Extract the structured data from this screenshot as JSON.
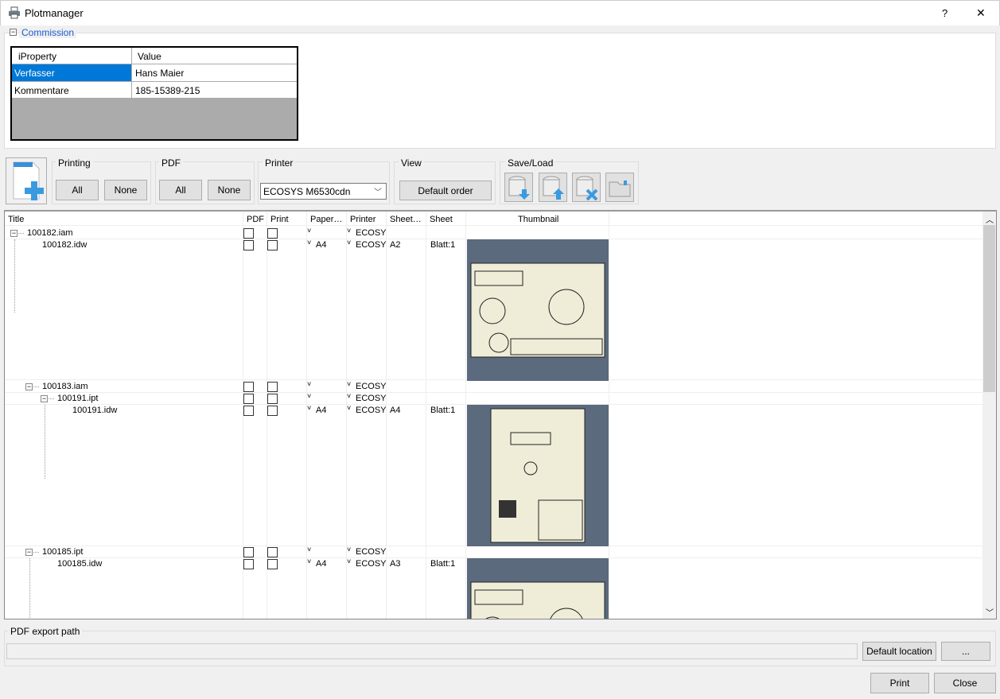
{
  "window": {
    "title": "Plotmanager",
    "help": "?",
    "close": "✕"
  },
  "commission": {
    "label": "Commission",
    "headers": [
      "iProperty",
      "Value"
    ],
    "rows": [
      {
        "k": "Verfasser",
        "v": "Hans Maier"
      },
      {
        "k": "Kommentare",
        "v": "185-15389-215"
      }
    ]
  },
  "toolbar": {
    "printing": {
      "label": "Printing",
      "all": "All",
      "none": "None"
    },
    "pdf": {
      "label": "PDF",
      "all": "All",
      "none": "None"
    },
    "printer": {
      "label": "Printer",
      "value": "ECOSYS M6530cdn"
    },
    "view": {
      "label": "View",
      "default_order": "Default order"
    },
    "saveload": {
      "label": "Save/Load"
    }
  },
  "grid": {
    "headers": [
      "Title",
      "PDF",
      "Print",
      "Paper…",
      "Printer",
      "Sheet…",
      "Sheet",
      "Thumbnail"
    ],
    "rows": [
      {
        "title": "100182.iam",
        "paper": "",
        "printer": "ECOSY",
        "size": "",
        "sheet": ""
      },
      {
        "title": "100182.idw",
        "paper": "A4",
        "printer": "ECOSY",
        "size": "A2",
        "sheet": "Blatt:1"
      },
      {
        "title": "100183.iam",
        "paper": "",
        "printer": "ECOSY",
        "size": "",
        "sheet": ""
      },
      {
        "title": "100191.ipt",
        "paper": "",
        "printer": "ECOSY",
        "size": "",
        "sheet": ""
      },
      {
        "title": "100191.idw",
        "paper": "A4",
        "printer": "ECOSY",
        "size": "A4",
        "sheet": "Blatt:1"
      },
      {
        "title": "100185.ipt",
        "paper": "",
        "printer": "ECOSY",
        "size": "",
        "sheet": ""
      },
      {
        "title": "100185.idw",
        "paper": "A4",
        "printer": "ECOSY",
        "size": "A3",
        "sheet": "Blatt:1"
      }
    ]
  },
  "export": {
    "label": "PDF export path",
    "path": "",
    "default_location": "Default location",
    "browse": "..."
  },
  "footer": {
    "print": "Print",
    "close": "Close"
  }
}
